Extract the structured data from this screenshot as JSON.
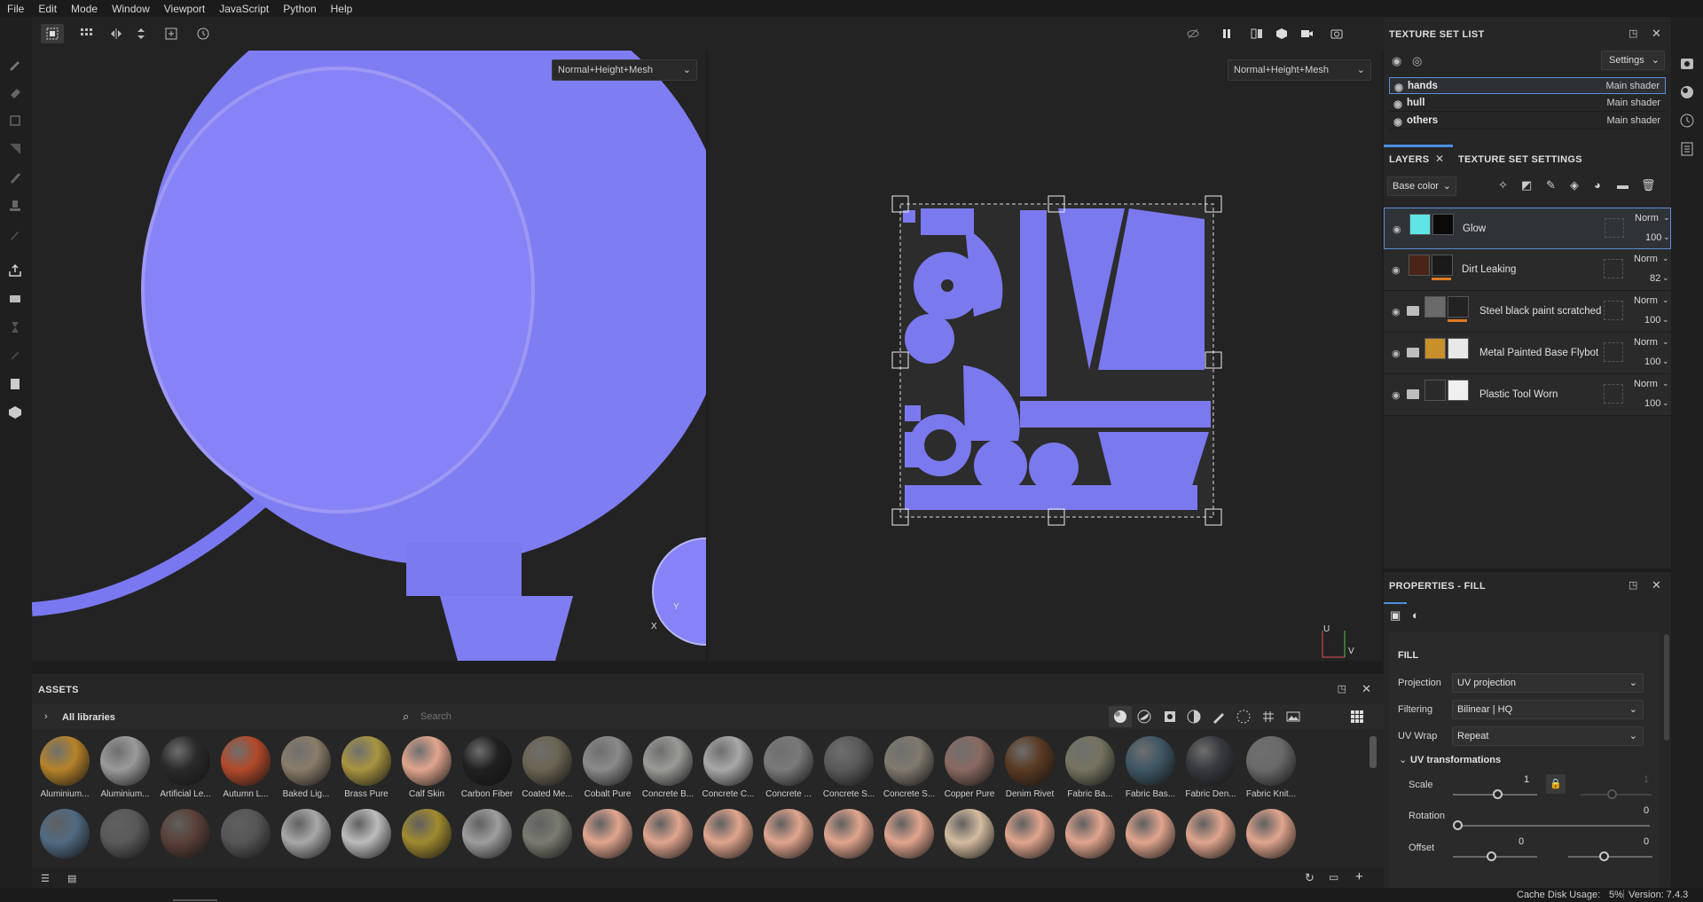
{
  "menu": [
    "File",
    "Edit",
    "Mode",
    "Window",
    "Viewport",
    "JavaScript",
    "Python",
    "Help"
  ],
  "viewport3d": {
    "channel": "Normal+Height+Mesh",
    "axis_y": "Y",
    "axis_x": "X"
  },
  "viewport2d": {
    "channel": "Normal+Height+Mesh",
    "axis_u": "U",
    "axis_v": "V"
  },
  "texture_set_list": {
    "title": "TEXTURE SET LIST",
    "settings_label": "Settings",
    "items": [
      {
        "name": "hands",
        "shader": "Main shader"
      },
      {
        "name": "hull",
        "shader": "Main shader"
      },
      {
        "name": "others",
        "shader": "Main shader"
      }
    ]
  },
  "layers": {
    "tab_layers": "LAYERS",
    "tab_settings": "TEXTURE SET SETTINGS",
    "channel": "Base color",
    "items": [
      {
        "name": "Glow",
        "blend": "Norm",
        "opacity": "100",
        "color1": "#5ee6e6",
        "color2": "#0a0a0a"
      },
      {
        "name": "Dirt Leaking",
        "blend": "Norm",
        "opacity": "82",
        "color1": "#4a2418",
        "color2": "#1a1a1a"
      },
      {
        "name": "Steel black paint scratched",
        "blend": "Norm",
        "opacity": "100",
        "color1": "#6a6a6a",
        "color2": "#222222"
      },
      {
        "name": "Metal Painted Base Flybot",
        "blend": "Norm",
        "opacity": "100",
        "color1": "#c8902a",
        "color2": "#e8e8e8"
      },
      {
        "name": "Plastic Tool Worn",
        "blend": "Norm",
        "opacity": "100",
        "color1": "#2a2a2a",
        "color2": "#f0f0f0"
      }
    ]
  },
  "properties": {
    "title": "PROPERTIES - FILL",
    "section": "FILL",
    "projection_label": "Projection",
    "projection": "UV projection",
    "filtering_label": "Filtering",
    "filtering": "Bilinear | HQ",
    "uvwrap_label": "UV Wrap",
    "uvwrap": "Repeat",
    "uv_transform": "UV transformations",
    "scale_label": "Scale",
    "scale": "1",
    "scale2": "1",
    "rotation_label": "Rotation",
    "rotation": "0",
    "offset_label": "Offset",
    "offset_x": "0",
    "offset_y": "0"
  },
  "assets": {
    "title": "ASSETS",
    "library": "All libraries",
    "search_placeholder": "Search",
    "row1": [
      {
        "label": "Aluminium...",
        "color": "#b5832a"
      },
      {
        "label": "Aluminium...",
        "color": "#9a9a9a"
      },
      {
        "label": "Artificial Le...",
        "color": "#2a2a2a"
      },
      {
        "label": "Autumn L...",
        "color": "#b24a2a"
      },
      {
        "label": "Baked Lig...",
        "color": "#8a7c6a"
      },
      {
        "label": "Brass Pure",
        "color": "#a89440"
      },
      {
        "label": "Calf Skin",
        "color": "#e0a58e"
      },
      {
        "label": "Carbon Fiber",
        "color": "#202020"
      },
      {
        "label": "Coated Me...",
        "color": "#6a6452"
      },
      {
        "label": "Cobalt Pure",
        "color": "#8a8a8a"
      },
      {
        "label": "Concrete B...",
        "color": "#9a9a96"
      },
      {
        "label": "Concrete C...",
        "color": "#a8a8a8"
      },
      {
        "label": "Concrete ...",
        "color": "#7a7a7a"
      },
      {
        "label": "Concrete S...",
        "color": "#5a5a5a"
      },
      {
        "label": "Concrete S...",
        "color": "#807a6e"
      },
      {
        "label": "Copper Pure",
        "color": "#8a6a62"
      },
      {
        "label": "Denim Rivet",
        "color": "#5a3a22"
      },
      {
        "label": "Fabric Ba...",
        "color": "#767460"
      },
      {
        "label": "Fabric Bas...",
        "color": "#3e5664"
      },
      {
        "label": "Fabric Den...",
        "color": "#36393e"
      },
      {
        "label": "Fabric Knit...",
        "color": "#6a6a6a"
      }
    ],
    "row2": [
      "#506a82",
      "#5a5a5a",
      "#5a4038",
      "#565656",
      "#a8a8a8",
      "#bcbcbc",
      "#a08a30",
      "#9e9e9e",
      "#7a7a70",
      "#e0a58e",
      "#e0a58e",
      "#e0a58e",
      "#e0a58e",
      "#e0a58e",
      "#e0a58e",
      "#d4bca0",
      "#e0a58e",
      "#e0a58e",
      "#e0a58e",
      "#e0a58e",
      "#e0a58e"
    ]
  },
  "status": {
    "cache_label": "Cache Disk Usage:",
    "cache_value": "5%",
    "version": "Version: 7.4.3"
  }
}
